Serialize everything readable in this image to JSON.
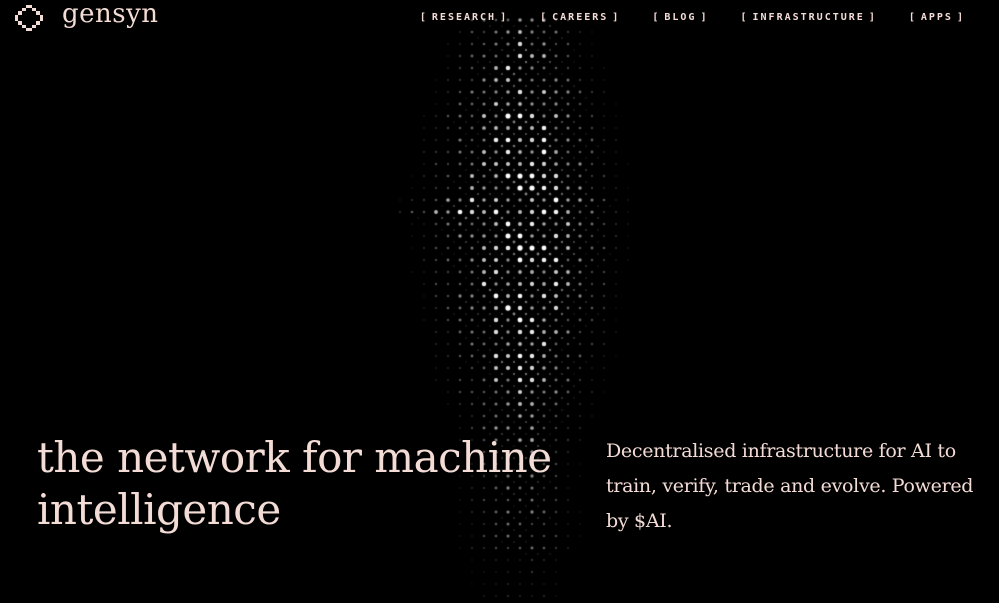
{
  "brand": {
    "name": "gensyn",
    "text_color": "#f4dcd6",
    "background_color": "#000000"
  },
  "nav": {
    "items": [
      {
        "label": "RESEARCH"
      },
      {
        "label": "CAREERS"
      },
      {
        "label": "BLOG"
      },
      {
        "label": "INFRASTRUCTURE"
      },
      {
        "label": "APPS"
      }
    ],
    "bracket_open": "[",
    "bracket_close": "]"
  },
  "hero": {
    "headline": "the network for machine intelligence",
    "tagline": "Decentralised infrastructure for AI to train, verify, trade and evolve. Powered by $AI."
  },
  "background": {
    "pattern": "dot-matrix-grid",
    "dot_color": "#ffffff"
  }
}
